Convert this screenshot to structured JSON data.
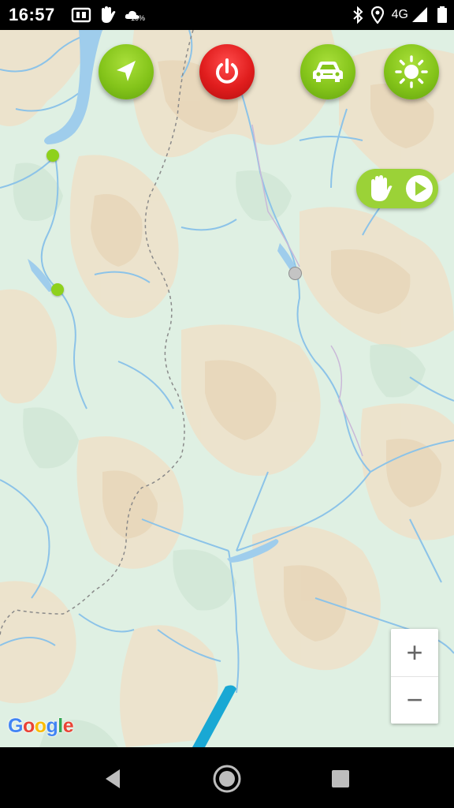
{
  "status_bar": {
    "time": "16:57",
    "weather_percent": "10%",
    "network": "4G",
    "icons": [
      "portrait-mode-icon",
      "hand-gesture-icon",
      "weather-cloud-icon",
      "bluetooth-icon",
      "location-icon",
      "signal-icon"
    ]
  },
  "toolbar": {
    "buttons": [
      {
        "name": "navigate-button",
        "icon": "navigation-arrow-icon",
        "color": "#84c41a"
      },
      {
        "name": "power-button",
        "icon": "power-icon",
        "color": "#e01d1d"
      },
      {
        "name": "car-mode-button",
        "icon": "car-icon",
        "color": "#84c41a"
      },
      {
        "name": "brightness-button",
        "icon": "sun-icon",
        "color": "#84c41a"
      }
    ]
  },
  "gesture_control": {
    "icons": [
      "hand-icon",
      "play-icon"
    ],
    "color": "#9bd237"
  },
  "map": {
    "attribution": "Google",
    "zoom": {
      "in_label": "+",
      "out_label": "−"
    },
    "markers": [
      {
        "name": "waypoint-marker-green",
        "color": "#8ed11c"
      },
      {
        "name": "waypoint-marker-green",
        "color": "#8ed11c"
      },
      {
        "name": "current-location-marker",
        "color": "#c4c4c4"
      }
    ]
  },
  "nav_bar": {
    "icons": [
      "back-icon",
      "home-icon",
      "recents-icon"
    ]
  }
}
